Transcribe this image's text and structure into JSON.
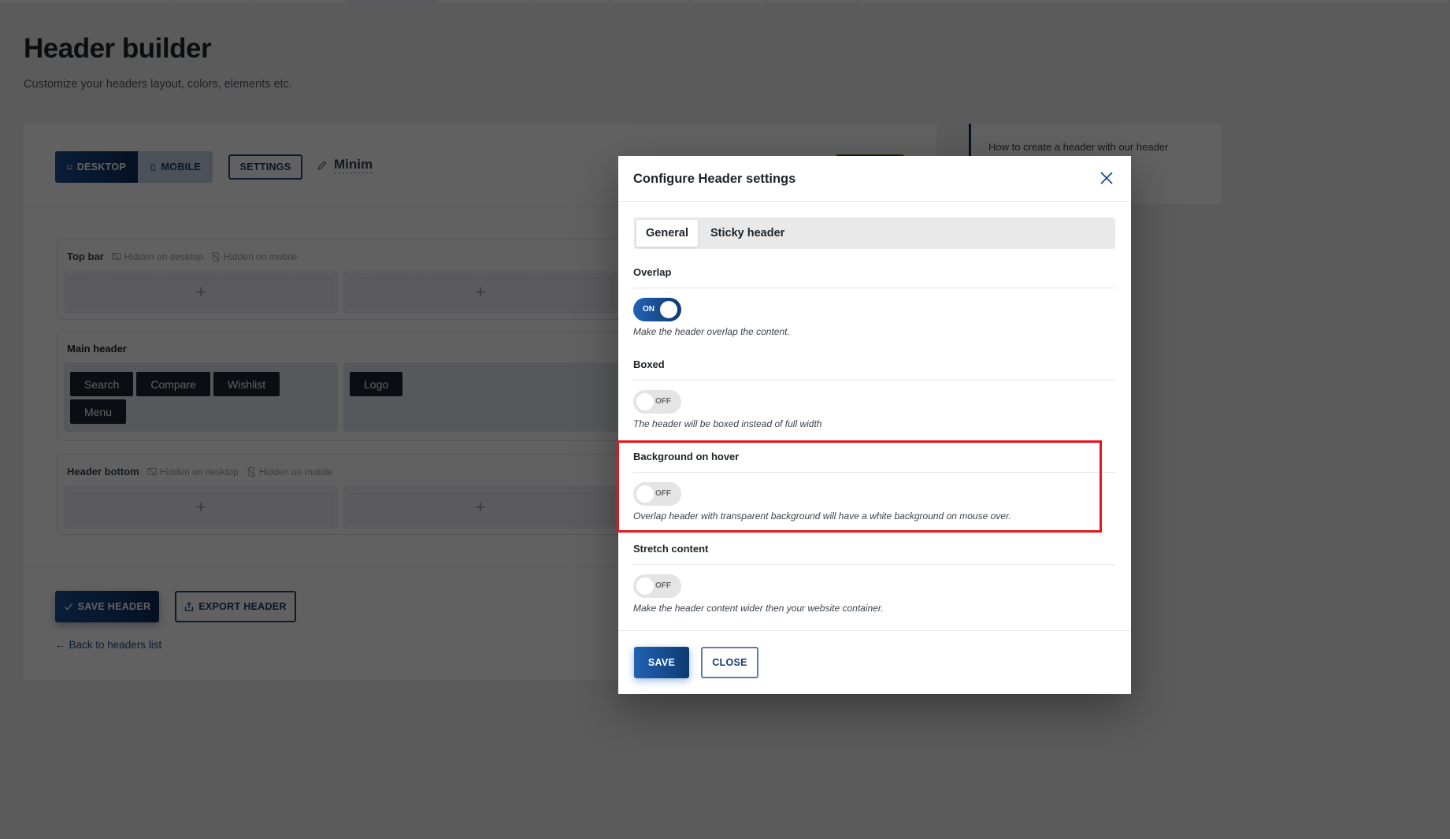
{
  "top_tabs": [
    {
      "active": false
    },
    {
      "active": false
    },
    {
      "active": false
    },
    {
      "active": true
    },
    {
      "active": false
    },
    {
      "active": false
    },
    {
      "active": false
    },
    {
      "active": false
    },
    {
      "active": false
    },
    {
      "active": false
    }
  ],
  "page": {
    "title": "Header builder",
    "subtitle": "Customize your headers layout, colors, elements etc."
  },
  "toolbar": {
    "desktop_label": "DESKTOP",
    "mobile_label": "MOBILE",
    "active_view": "desktop",
    "settings_label": "SETTINGS",
    "header_name": "Minim"
  },
  "rows": {
    "top_bar": {
      "name": "Top bar",
      "hidden_desktop": "Hidden on desktop",
      "hidden_mobile": "Hidden on mobile",
      "add_symbol": "+"
    },
    "main_header": {
      "name": "Main header",
      "left_elements": [
        "Search",
        "Compare",
        "Wishlist",
        "Menu"
      ],
      "center_elements": [
        "Logo"
      ]
    },
    "header_bottom": {
      "name": "Header bottom",
      "hidden_desktop": "Hidden on desktop",
      "hidden_mobile": "Hidden on mobile",
      "add_symbol": "+"
    }
  },
  "footer": {
    "save_label": "SAVE HEADER",
    "export_label": "EXPORT HEADER",
    "back_label": "Back to headers list"
  },
  "info_box": {
    "text": "How to create a header with our header"
  },
  "modal": {
    "title": "Configure Header settings",
    "tabs": [
      {
        "label": "General",
        "active": true
      },
      {
        "label": "Sticky header",
        "active": false
      }
    ],
    "settings": [
      {
        "label": "Overlap",
        "state": "ON",
        "enabled": true,
        "description": "Make the header overlap the content."
      },
      {
        "label": "Boxed",
        "state": "OFF",
        "enabled": false,
        "description": "The header will be boxed instead of full width"
      },
      {
        "label": "Background on hover",
        "state": "OFF",
        "enabled": false,
        "description": "Overlap header with transparent background will have a white background on mouse over.",
        "highlighted": true
      },
      {
        "label": "Stretch content",
        "state": "OFF",
        "enabled": false,
        "description": "Make the header content wider then your website container."
      }
    ],
    "save_label": "SAVE",
    "close_label": "CLOSE"
  },
  "colors": {
    "primary": "#1b4f93",
    "primary_dark": "#0d2d5a",
    "highlight": "#e8141c",
    "publish_green": "#2b6d1a"
  }
}
